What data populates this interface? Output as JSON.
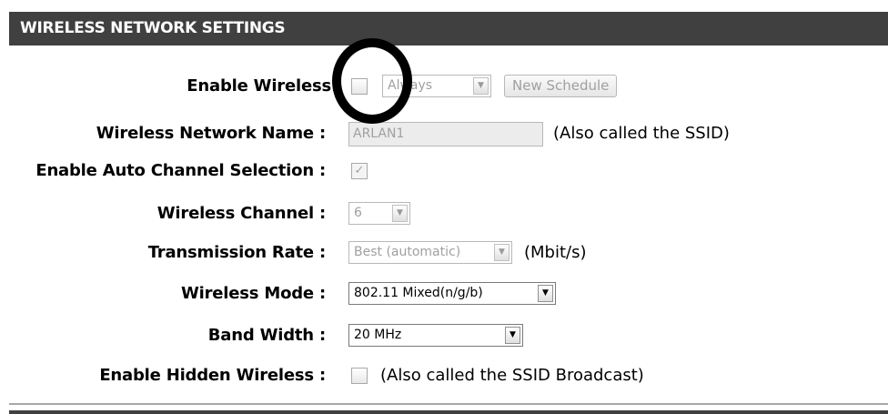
{
  "section": {
    "title": "WIRELESS NETWORK SETTINGS"
  },
  "rows": {
    "enable_wireless": {
      "label": "Enable Wireless",
      "checked": false,
      "schedule": "Always",
      "schedule_button": "New Schedule"
    },
    "network_name": {
      "label": "Wireless Network Name :",
      "value": "ARLAN1",
      "note": "(Also called the SSID)"
    },
    "auto_channel": {
      "label": "Enable Auto Channel Selection :",
      "checked": true
    },
    "channel": {
      "label": "Wireless Channel :",
      "value": "6"
    },
    "transmission_rate": {
      "label": "Transmission Rate :",
      "value": "Best (automatic)",
      "unit": "(Mbit/s)"
    },
    "wireless_mode": {
      "label": "Wireless Mode :",
      "value": "802.11 Mixed(n/g/b)"
    },
    "band_width": {
      "label": "Band Width :",
      "value": "20 MHz"
    },
    "hidden_wireless": {
      "label": "Enable Hidden Wireless :",
      "checked": false,
      "note": "(Also called the SSID Broadcast)"
    }
  },
  "icons": {
    "dropdown": "chevron-down-icon",
    "checkmark": "checkmark-icon",
    "annotation": "circle-highlight"
  },
  "colors": {
    "header_bg": "#404040",
    "header_text": "#ffffff",
    "disabled_text": "#a0a0a0",
    "annotation": "#000000"
  }
}
